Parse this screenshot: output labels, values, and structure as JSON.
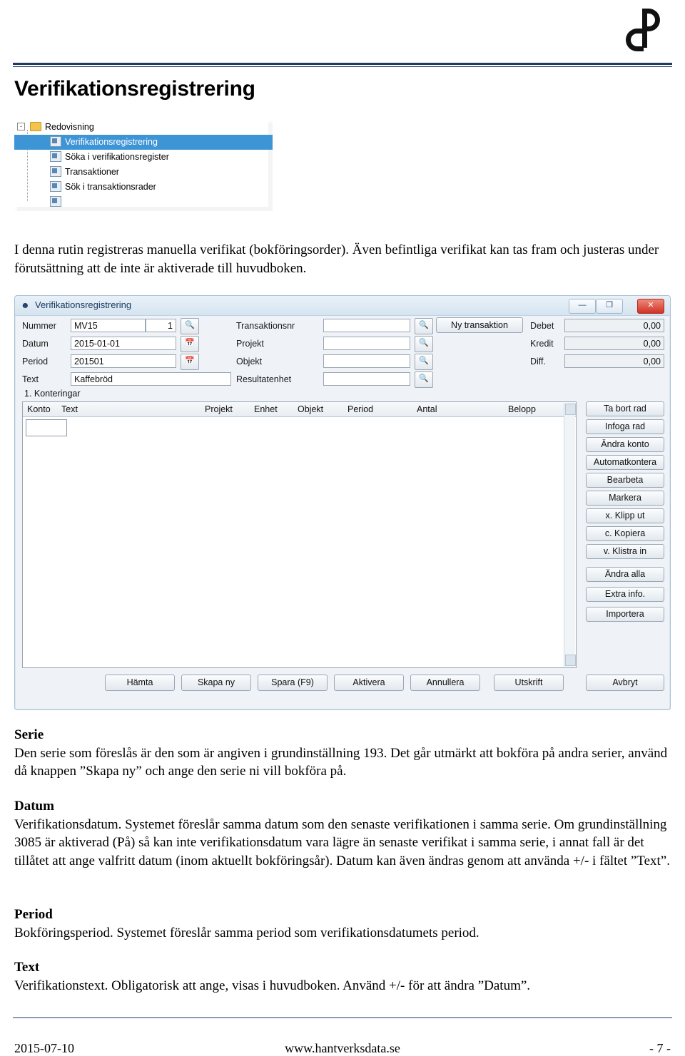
{
  "logo": {
    "name": "ab-logo"
  },
  "title": "Verifikationsregistrering",
  "tree": {
    "items": [
      {
        "label": "Redovisning",
        "icon": "folder-icon",
        "selected": false,
        "level": 0
      },
      {
        "label": "Verifikationsregistrering",
        "icon": "document-icon",
        "selected": true,
        "level": 1
      },
      {
        "label": "Söka i verifikationsregister",
        "icon": "document-icon",
        "selected": false,
        "level": 1
      },
      {
        "label": "Transaktioner",
        "icon": "document-icon",
        "selected": false,
        "level": 1
      },
      {
        "label": "Sök i transaktionsrader",
        "icon": "document-icon",
        "selected": false,
        "level": 1
      }
    ]
  },
  "intro": "I denna rutin registreras manuella verifikat (bokföringsorder). Även befintliga verifikat kan tas fram och justeras under förutsättning att de inte är aktiverade till huvudboken.",
  "app": {
    "window_title": "Verifikationsregistrering",
    "window_buttons": {
      "minimize": "—",
      "maximize": "❐",
      "close": "✕"
    },
    "fields": {
      "nummer_label": "Nummer",
      "nummer_serie": "MV15",
      "nummer_nr": "1",
      "datum_label": "Datum",
      "datum_value": "2015-01-01",
      "period_label": "Period",
      "period_value": "201501",
      "text_label": "Text",
      "text_value": "Kaffebröd",
      "transaktionsnr_label": "Transaktionsnr",
      "transaktionsnr_value": "",
      "projekt_label": "Projekt",
      "projekt_value": "",
      "objekt_label": "Objekt",
      "objekt_value": "",
      "resultatenhet_label": "Resultatenhet",
      "resultatenhet_value": "",
      "debet_label": "Debet",
      "debet_value": "0,00",
      "kredit_label": "Kredit",
      "kredit_value": "0,00",
      "diff_label": "Diff.",
      "diff_value": "0,00"
    },
    "ny_transaktion_button": "Ny transaktion",
    "group_label": "1. Konteringar",
    "grid_columns": [
      "Konto",
      "Text",
      "Projekt",
      "Enhet",
      "Objekt",
      "Period",
      "Antal",
      "Belopp"
    ],
    "grid_rows": [],
    "side_buttons": [
      "Ta bort rad",
      "Infoga rad",
      "Ändra konto",
      "Automatkontera",
      "Bearbeta",
      "Markera",
      "x. Klipp ut",
      "c. Kopiera",
      "v. Klistra in",
      "Ändra alla",
      "Extra info.",
      "Importera"
    ],
    "bottom_buttons": [
      "Hämta",
      "Skapa ny",
      "Spara (F9)",
      "Aktivera",
      "Annullera",
      "Utskrift",
      "Avbryt"
    ]
  },
  "sections": [
    {
      "heading": "Serie",
      "body": "Den serie som föreslås är den som är angiven i grundinställning 193. Det går utmärkt att bokföra på andra serier, använd då knappen ”Skapa ny” och ange den serie ni vill bokföra på."
    },
    {
      "heading": "Datum",
      "body": "Verifikationsdatum. Systemet föreslår samma datum som den senaste verifikationen i samma serie. Om grundinställning 3085 är aktiverad (På) så kan inte verifikationsdatum vara lägre än senaste verifikat i samma serie, i annat fall är det tillåtet att ange valfritt datum (inom aktuellt bokföringsår). Datum kan även ändras genom att använda +/- i fältet ”Text”."
    },
    {
      "heading": "Period",
      "body": "Bokföringsperiod. Systemet föreslår samma period som verifikationsdatumets period."
    },
    {
      "heading": "Text",
      "body": "Verifikationstext. Obligatorisk att ange, visas i huvudboken. Använd +/- för att ändra ”Datum”."
    }
  ],
  "footer": {
    "date": "2015-07-10",
    "site": "www.hantverksdata.se",
    "page": "- 7 -"
  },
  "colors": {
    "rule": "#1f3864",
    "selection": "#3e95d6",
    "accent": "#17375e"
  }
}
